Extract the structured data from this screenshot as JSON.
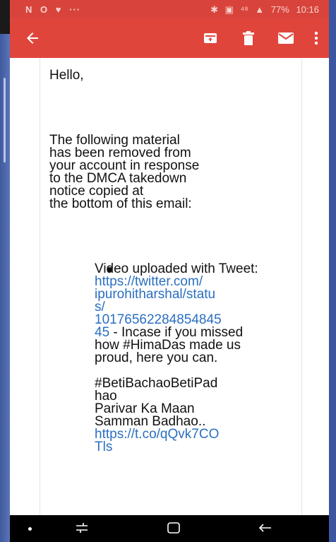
{
  "status_bar": {
    "left_icons": [
      "N",
      "O",
      "♥",
      "···"
    ],
    "right_icons": [
      "✱",
      "▣",
      "⁴⁸",
      "▲"
    ],
    "battery": "77%",
    "time": "10:16"
  },
  "app_bar": {
    "icons": [
      "back-arrow-icon",
      "archive-icon",
      "delete-icon",
      "mail-icon",
      "more-vert-icon"
    ]
  },
  "email": {
    "greeting": "Hello,",
    "paragraph": "The following material\nhas been removed from\nyour account in response\nto the DMCA takedown\nnotice copied at\nthe bottom of this email:",
    "item": {
      "lead": "Video uploaded with Tweet:",
      "link1_lines": [
        "https://twitter.com/",
        "ipurohitharshal/statu",
        "s/",
        "10176562284854845",
        "45"
      ],
      "after_link1": " - Incase if you missed how #HimaDas made us proud, here you can.",
      "hashtag_lines": [
        "#BetiBachaoBetiPad",
        "hao"
      ],
      "tagline_lines": [
        "Parivar Ka Maan",
        "Samman Badhao.."
      ],
      "link2_lines": [
        "https://t.co/qQvk7CO",
        "Tls"
      ]
    }
  },
  "nav_bar": {
    "icons": [
      "dot-icon",
      "recent-apps-icon",
      "home-icon",
      "back-icon"
    ]
  }
}
